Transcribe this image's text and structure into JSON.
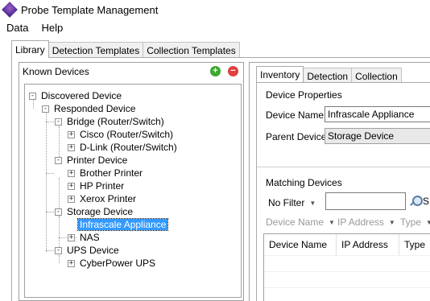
{
  "window": {
    "title": "Probe Template Management",
    "icon": "probe-app-icon"
  },
  "menu": {
    "items": [
      "Data",
      "Help"
    ]
  },
  "main_tabs": [
    {
      "label": "Library",
      "active": true
    },
    {
      "label": "Detection Templates",
      "active": false
    },
    {
      "label": "Collection Templates",
      "active": false
    }
  ],
  "known_devices": {
    "header": "Known Devices",
    "add_icon": "add-icon",
    "remove_icon": "remove-icon",
    "tree": [
      {
        "label": "Discovered Device",
        "expander": "-"
      },
      {
        "label": "Responded Device",
        "expander": "-"
      },
      {
        "label": "Bridge (Router/Switch)",
        "expander": "-"
      },
      {
        "label": "Cisco (Router/Switch)",
        "expander": "+"
      },
      {
        "label": "D-Link (Router/Switch)",
        "expander": "+"
      },
      {
        "label": "Printer Device",
        "expander": "-"
      },
      {
        "label": "Brother Printer",
        "expander": "+"
      },
      {
        "label": "HP Printer",
        "expander": "+"
      },
      {
        "label": "Xerox Printer",
        "expander": "+"
      },
      {
        "label": "Storage Device",
        "expander": "-"
      },
      {
        "label": "Infrascale Appliance",
        "expander": "",
        "selected": true
      },
      {
        "label": "NAS",
        "expander": "+"
      },
      {
        "label": "UPS Device",
        "expander": "-"
      },
      {
        "label": "CyberPower UPS",
        "expander": "+"
      }
    ]
  },
  "right_tabs": [
    {
      "label": "Inventory",
      "active": true
    },
    {
      "label": "Detection",
      "active": false
    },
    {
      "label": "Collection",
      "active": false
    }
  ],
  "device_properties": {
    "title": "Device Properties",
    "device_name_label": "Device Name:",
    "device_name_value": "Infrascale Appliance",
    "parent_device_label": "Parent Device:",
    "parent_device_value": "Storage Device"
  },
  "matching_devices": {
    "title": "Matching Devices",
    "filter_label": "No Filter",
    "search_button_label": "S",
    "column_filters": [
      "Device Name",
      "IP Address",
      "Type"
    ],
    "grid_columns": [
      "Device Name",
      "IP Address",
      "Type"
    ]
  }
}
